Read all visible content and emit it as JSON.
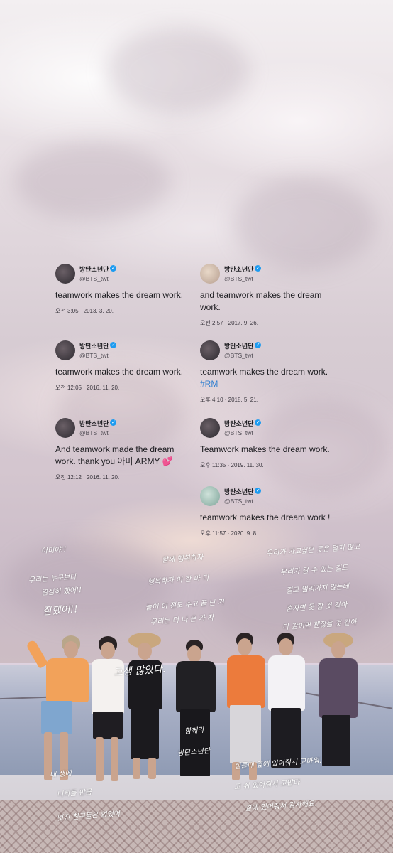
{
  "tweets": [
    {
      "name": "방탄소년단",
      "handle": "@BTS_twt",
      "text": "teamwork makes the dream work.",
      "tag": "",
      "time": "오전 3:05",
      "date": "2013. 3. 20."
    },
    {
      "name": "방탄소년단",
      "handle": "@BTS_twt",
      "text": "and teamwork makes the dream work.",
      "tag": "",
      "time": "오전 2:57",
      "date": "2017. 9. 26."
    },
    {
      "name": "방탄소년단",
      "handle": "@BTS_twt",
      "text": "teamwork makes the dream work.",
      "tag": "",
      "time": "오전 12:05",
      "date": "2016. 11. 20."
    },
    {
      "name": "방탄소년단",
      "handle": "@BTS_twt",
      "text": "teamwork makes the dream work.",
      "tag": "#RM",
      "time": "오후 4:10",
      "date": "2018. 5. 21."
    },
    {
      "name": "방탄소년단",
      "handle": "@BTS_twt",
      "text": "And teamwork made the dream work. thank you 아미 ARMY",
      "tag": "",
      "time": "오전 12:12",
      "date": "2016. 11. 20."
    },
    {
      "name": "방탄소년단",
      "handle": "@BTS_twt",
      "text": "Teamwork makes the dream work.",
      "tag": "",
      "time": "오후 11:35",
      "date": "2019. 11. 30."
    },
    {
      "name": "방탄소년단",
      "handle": "@BTS_twt",
      "text": "teamwork makes the dream work !",
      "tag": "",
      "time": "오후 11:57",
      "date": "2020. 9. 8."
    }
  ],
  "separator": "·",
  "verified_icon": "verified-badge-icon",
  "heart_glyph": "💕",
  "notes": {
    "n1": "아미야!!",
    "n2": "우리는 누구보다",
    "n3": "열심히 했어!!",
    "n4": "잘했어!!",
    "n5": "함께 행복하자",
    "n6": "행복하자 어 한 마 디",
    "n7": "늘어 이 정도 수고 끝 난 거",
    "n8": "우리는 더 나 은 가 자",
    "n9": "우리가 가고싶은 곳은 멀지 않고",
    "n10": "우리가 갈 수 있는 길도",
    "n11": "결코 멀리가지 않는데",
    "n12": "혼자면 못 할 것 같아",
    "n13": "다 같이면 괜찮을 것 같아",
    "n14": "고생 많았다.",
    "n15": "함께라",
    "n16": "방탄소년단",
    "n17": "내 생에",
    "n18": "너희들 만큼",
    "n19": "멋진 친구들은 없었어",
    "n20": "힘들때 옆에 있어줘서 고마워.",
    "n21": "고 쉬 있어줘서 고맙다",
    "n22": "곁에 있어줘서 감사해요."
  }
}
